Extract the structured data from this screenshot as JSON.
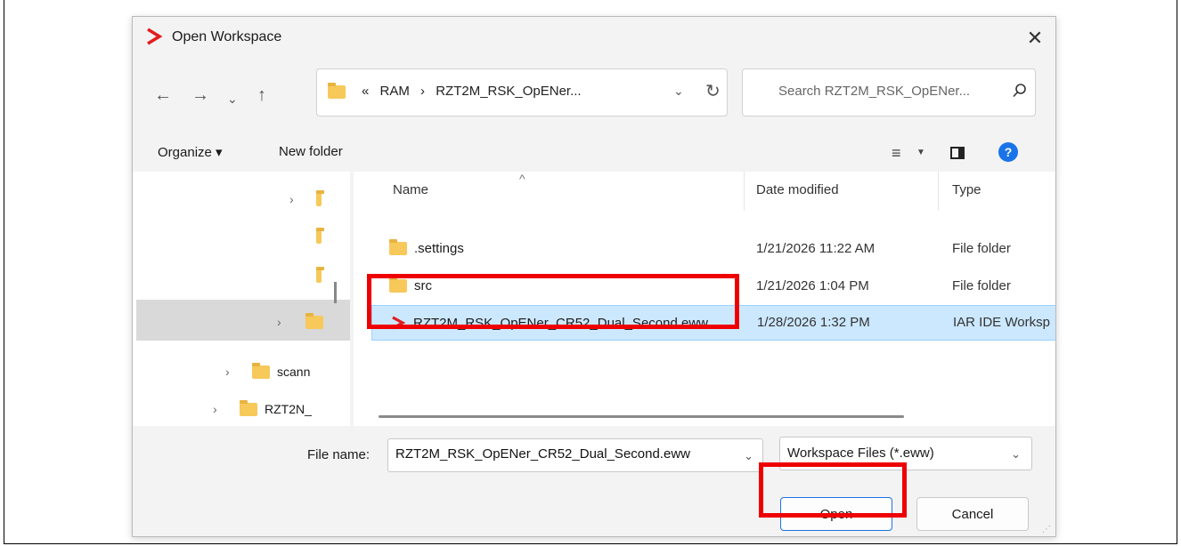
{
  "dialog": {
    "title": "Open Workspace",
    "close_label": "✕"
  },
  "address": {
    "overflow": "«",
    "segments": [
      "RAM",
      "›",
      "RZT2M_RSK_OpENer..."
    ]
  },
  "search": {
    "placeholder": "Search RZT2M_RSK_OpENer..."
  },
  "toolbar": {
    "organize": "Organize ▾",
    "new_folder": "New folder",
    "help": "?"
  },
  "nav_pane": {
    "items": [
      {
        "label": ""
      },
      {
        "label": ""
      },
      {
        "label": ""
      },
      {
        "label": ""
      },
      {
        "label": "scann"
      },
      {
        "label": "RZT2N_"
      }
    ]
  },
  "columns": {
    "name": "Name",
    "date": "Date modified",
    "type": "Type"
  },
  "files": [
    {
      "name": ".settings",
      "date": "1/21/2026 11:22 AM",
      "type": "File folder",
      "icon": "folder-icon"
    },
    {
      "name": "src",
      "date": "1/21/2026 1:04 PM",
      "type": "File folder",
      "icon": "folder-icon"
    },
    {
      "name": "RZT2M_RSK_OpENer_CR52_Dual_Second.eww",
      "date": "1/28/2026 1:32 PM",
      "type": "IAR IDE Worksp",
      "icon": "iar-workspace-icon",
      "selected": true
    }
  ],
  "bottom": {
    "file_name_label": "File name:",
    "file_name_value": "RZT2M_RSK_OpENer_CR52_Dual_Second.eww",
    "filter_value": "Workspace Files (*.eww)",
    "open_label": "Open",
    "cancel_label": "Cancel"
  },
  "colors": {
    "accent": "#1a73e8",
    "selection": "#cce8ff",
    "highlight": "#ee0000",
    "iar_red": "#e11d1d"
  }
}
